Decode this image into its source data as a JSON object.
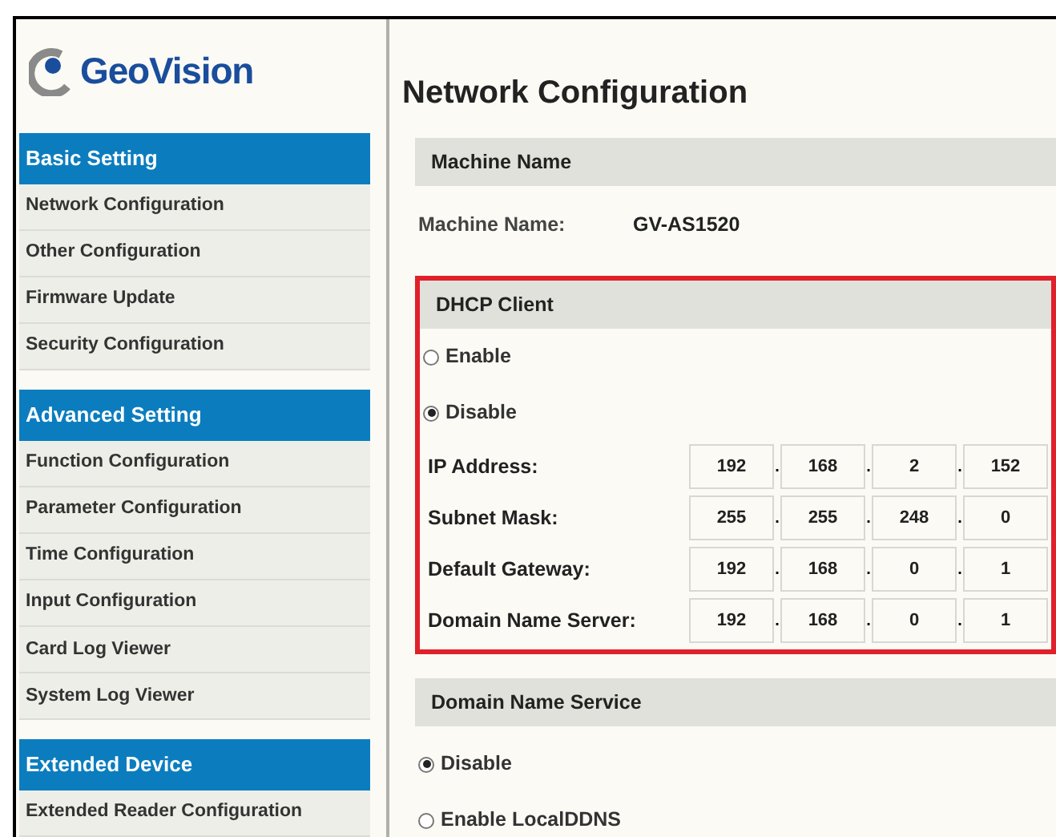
{
  "logo": {
    "text": "GeoVision"
  },
  "sidebar": {
    "sections": [
      {
        "title": "Basic Setting",
        "items": [
          {
            "label": "Network Configuration"
          },
          {
            "label": "Other Configuration"
          },
          {
            "label": "Firmware Update"
          },
          {
            "label": "Security Configuration"
          }
        ]
      },
      {
        "title": "Advanced Setting",
        "items": [
          {
            "label": "Function Configuration"
          },
          {
            "label": "Parameter Configuration"
          },
          {
            "label": "Time Configuration"
          },
          {
            "label": "Input Configuration"
          },
          {
            "label": "Card Log Viewer"
          },
          {
            "label": "System Log Viewer"
          }
        ]
      },
      {
        "title": "Extended Device",
        "items": [
          {
            "label": "Extended Reader Configuration"
          }
        ]
      }
    ]
  },
  "main": {
    "title": "Network Configuration",
    "machine_name": {
      "header": "Machine Name",
      "label": "Machine Name:",
      "value": "GV-AS1520"
    },
    "dhcp": {
      "header": "DHCP Client",
      "highlighted": true,
      "options": [
        {
          "label": "Enable",
          "selected": false
        },
        {
          "label": "Disable",
          "selected": true
        }
      ],
      "separator": ".",
      "fields": [
        {
          "label": "IP Address:",
          "octets": [
            "192",
            "168",
            "2",
            "152"
          ]
        },
        {
          "label": "Subnet Mask:",
          "octets": [
            "255",
            "255",
            "248",
            "0"
          ]
        },
        {
          "label": "Default Gateway:",
          "octets": [
            "192",
            "168",
            "0",
            "1"
          ]
        },
        {
          "label": "Domain Name Server:",
          "octets": [
            "192",
            "168",
            "0",
            "1"
          ]
        }
      ]
    },
    "dns": {
      "header": "Domain Name Service",
      "options": [
        {
          "label": "Disable",
          "selected": true
        },
        {
          "label": "Enable LocalDDNS",
          "selected": false
        }
      ]
    }
  }
}
